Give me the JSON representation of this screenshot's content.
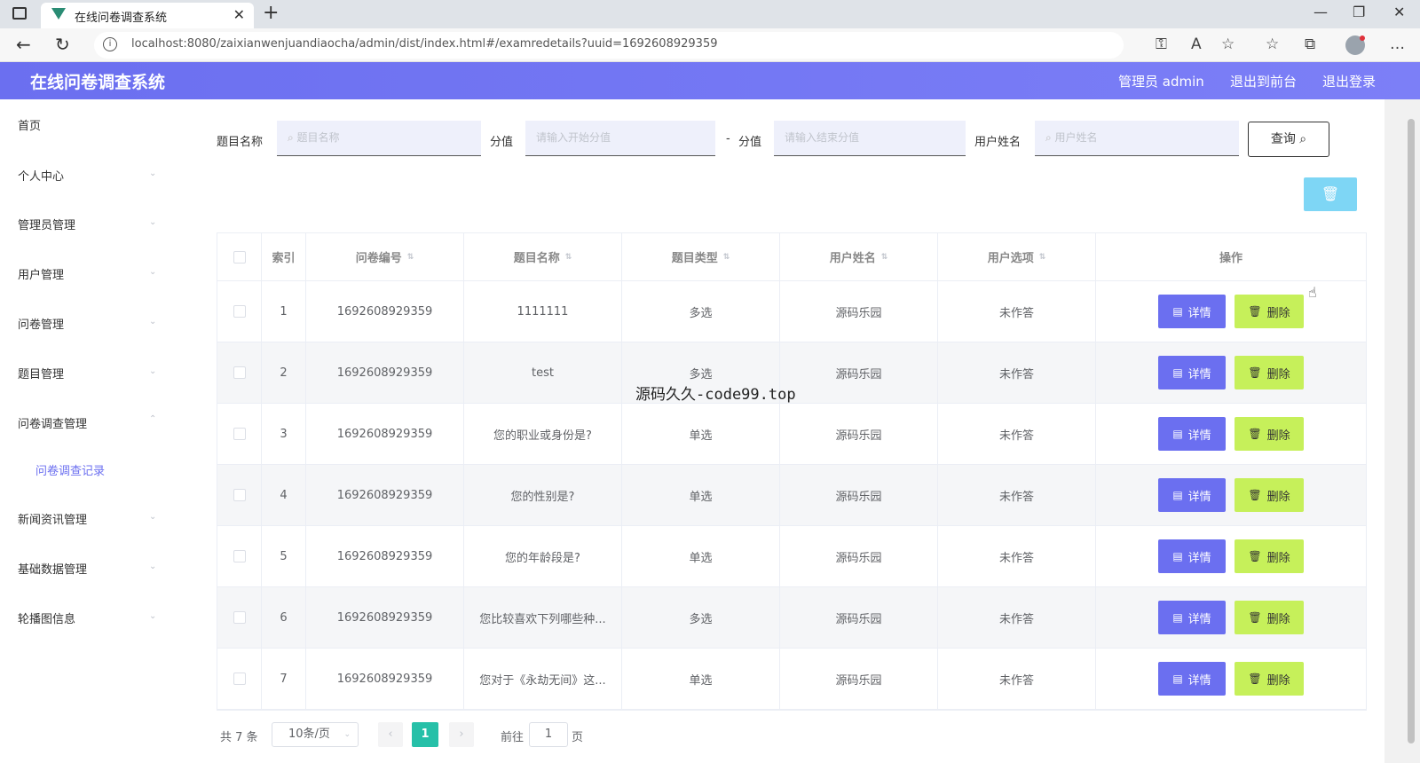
{
  "browser": {
    "tab_title": "在线问卷调查系统",
    "url": "localhost:8080/zaixianwenjuandiaocha/admin/dist/index.html#/examredetails?uuid=1692608929359"
  },
  "header": {
    "brand": "在线问卷调查系统",
    "admin_label": "管理员 admin",
    "front_link": "退出到前台",
    "logout_link": "退出登录",
    "accent_color": "#6b6ff0"
  },
  "sidebar": {
    "items": [
      {
        "label": "首页"
      },
      {
        "label": "个人中心"
      },
      {
        "label": "管理员管理"
      },
      {
        "label": "用户管理"
      },
      {
        "label": "问卷管理"
      },
      {
        "label": "题目管理"
      },
      {
        "label": "问卷调查管理"
      },
      {
        "label": "新闻资讯管理"
      },
      {
        "label": "基础数据管理"
      },
      {
        "label": "轮播图信息"
      }
    ],
    "sub_item": "问卷调查记录"
  },
  "search": {
    "title_label": "题目名称",
    "title_placeholder": "题目名称",
    "score_label": "分值",
    "score_start_placeholder": "请输入开始分值",
    "dash": "-",
    "score_label2": "分值",
    "score_end_placeholder": "请输入结束分值",
    "user_label": "用户姓名",
    "user_placeholder": "用户姓名",
    "query_button": "查询"
  },
  "table": {
    "headers": {
      "index": "索引",
      "survey_no": "问卷编号",
      "title": "题目名称",
      "type": "题目类型",
      "user": "用户姓名",
      "option": "用户选项",
      "actions": "操作"
    },
    "detail_label": "详情",
    "delete_label": "删除",
    "rows": [
      {
        "index": "1",
        "survey_no": "1692608929359",
        "title": "1111111",
        "type": "多选",
        "user": "源码乐园",
        "option": "未作答"
      },
      {
        "index": "2",
        "survey_no": "1692608929359",
        "title": "test",
        "type": "多选",
        "user": "源码乐园",
        "option": "未作答"
      },
      {
        "index": "3",
        "survey_no": "1692608929359",
        "title": "您的职业或身份是?",
        "type": "单选",
        "user": "源码乐园",
        "option": "未作答"
      },
      {
        "index": "4",
        "survey_no": "1692608929359",
        "title": "您的性别是?",
        "type": "单选",
        "user": "源码乐园",
        "option": "未作答"
      },
      {
        "index": "5",
        "survey_no": "1692608929359",
        "title": "您的年龄段是?",
        "type": "单选",
        "user": "源码乐园",
        "option": "未作答"
      },
      {
        "index": "6",
        "survey_no": "1692608929359",
        "title": "您比较喜欢下列哪些种...",
        "type": "多选",
        "user": "源码乐园",
        "option": "未作答"
      },
      {
        "index": "7",
        "survey_no": "1692608929359",
        "title": "您对于《永劫无间》这...",
        "type": "单选",
        "user": "源码乐园",
        "option": "未作答"
      }
    ]
  },
  "pagination": {
    "total": "共 7 条",
    "page_size": "10条/页",
    "current": "1",
    "goto_label": "前往",
    "goto_value": "1",
    "page_suffix": "页"
  },
  "overlay_text": "源码久久-code99.top"
}
